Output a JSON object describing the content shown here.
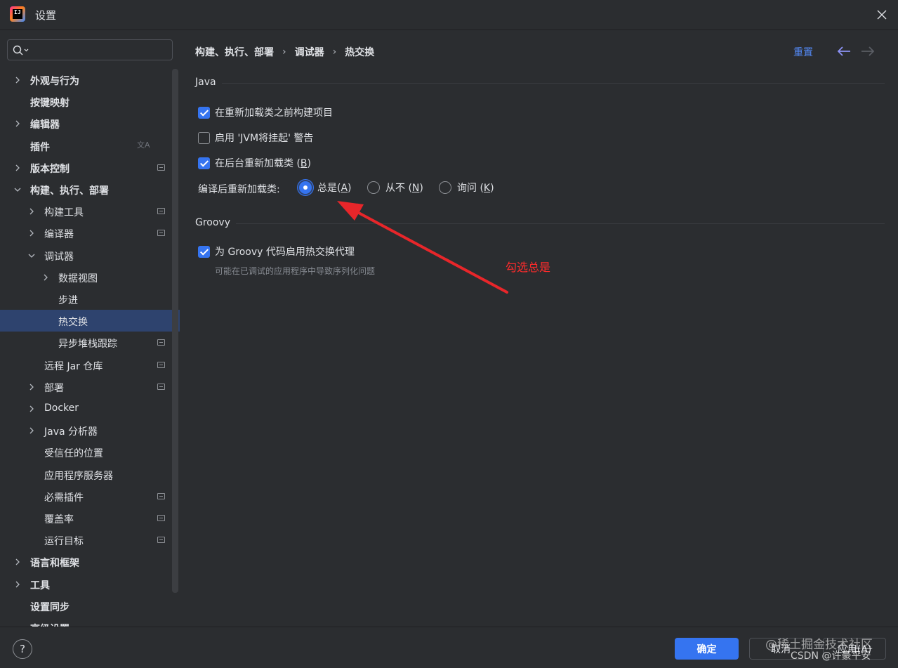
{
  "window": {
    "title": "设置",
    "logo_text": "IJ"
  },
  "search": {
    "placeholder": ""
  },
  "sidebar": {
    "items": [
      {
        "label": "外观与行为",
        "level": 0,
        "bold": true,
        "chevron": "right"
      },
      {
        "label": "按键映射",
        "level": 0,
        "bold": true,
        "chevron": "none"
      },
      {
        "label": "编辑器",
        "level": 0,
        "bold": true,
        "chevron": "right"
      },
      {
        "label": "插件",
        "level": 0,
        "bold": true,
        "chevron": "none",
        "icon": "translate-icon"
      },
      {
        "label": "版本控制",
        "level": 0,
        "bold": true,
        "chevron": "right",
        "badge": true
      },
      {
        "label": "构建、执行、部署",
        "level": 0,
        "bold": true,
        "chevron": "down"
      },
      {
        "label": "构建工具",
        "level": 1,
        "bold": false,
        "chevron": "right",
        "badge": true
      },
      {
        "label": "编译器",
        "level": 1,
        "bold": false,
        "chevron": "right",
        "badge": true
      },
      {
        "label": "调试器",
        "level": 1,
        "bold": false,
        "chevron": "down"
      },
      {
        "label": "数据视图",
        "level": 2,
        "bold": false,
        "chevron": "right"
      },
      {
        "label": "步进",
        "level": 2,
        "bold": false,
        "chevron": "none"
      },
      {
        "label": "热交换",
        "level": 2,
        "bold": false,
        "chevron": "none",
        "selected": true
      },
      {
        "label": "异步堆栈跟踪",
        "level": 2,
        "bold": false,
        "chevron": "none",
        "badge": true
      },
      {
        "label": "远程 Jar 仓库",
        "level": 1,
        "bold": false,
        "chevron": "none",
        "badge": true
      },
      {
        "label": "部署",
        "level": 1,
        "bold": false,
        "chevron": "right",
        "badge": true
      },
      {
        "label": "Docker",
        "level": 1,
        "bold": false,
        "chevron": "right"
      },
      {
        "label": "Java 分析器",
        "level": 1,
        "bold": false,
        "chevron": "right"
      },
      {
        "label": "受信任的位置",
        "level": 1,
        "bold": false,
        "chevron": "none"
      },
      {
        "label": "应用程序服务器",
        "level": 1,
        "bold": false,
        "chevron": "none"
      },
      {
        "label": "必需插件",
        "level": 1,
        "bold": false,
        "chevron": "none",
        "badge": true
      },
      {
        "label": "覆盖率",
        "level": 1,
        "bold": false,
        "chevron": "none",
        "badge": true
      },
      {
        "label": "运行目标",
        "level": 1,
        "bold": false,
        "chevron": "none",
        "badge": true
      },
      {
        "label": "语言和框架",
        "level": 0,
        "bold": true,
        "chevron": "right"
      },
      {
        "label": "工具",
        "level": 0,
        "bold": true,
        "chevron": "right"
      },
      {
        "label": "设置同步",
        "level": 0,
        "bold": true,
        "chevron": "none"
      },
      {
        "label": "高级设置",
        "level": 0,
        "bold": true,
        "chevron": "none"
      }
    ]
  },
  "header": {
    "breadcrumb": [
      "构建、执行、部署",
      "调试器",
      "热交换"
    ],
    "reset_label": "重置"
  },
  "java_section": {
    "title": "Java",
    "options": [
      {
        "label": "在重新加载类之前构建项目",
        "checked": true
      },
      {
        "label": "启用 'JVM将挂起' 警告",
        "checked": false
      },
      {
        "label_main": "在后台重新加载类 (",
        "label_mnemonic": "B",
        "label_end": ")",
        "checked": true
      }
    ],
    "reload_label": "编译后重新加载类:",
    "radio": [
      {
        "main": "总是(",
        "mnemonic": "A",
        "end": ")",
        "selected": true
      },
      {
        "main": "从不 (",
        "mnemonic": "N",
        "end": ")",
        "selected": false
      },
      {
        "main": "询问 (",
        "mnemonic": "K",
        "end": ")",
        "selected": false
      }
    ]
  },
  "groovy_section": {
    "title": "Groovy",
    "option": {
      "label": "为 Groovy 代码启用热交换代理",
      "checked": true
    },
    "hint": "可能在已调试的应用程序中导致序列化问题"
  },
  "annotation": {
    "text": "勾选总是",
    "color": "#ff2b2b"
  },
  "footer": {
    "help": "?",
    "ok": "确定",
    "cancel": "取消",
    "apply": "应用(A)",
    "watermark_top": "@稀土掘金技术社区",
    "watermark_bottom": "CSDN @许豪平安"
  },
  "colors": {
    "accent": "#3574f0",
    "selection": "#2e436e",
    "link": "#548af7",
    "background": "#2b2d30"
  }
}
